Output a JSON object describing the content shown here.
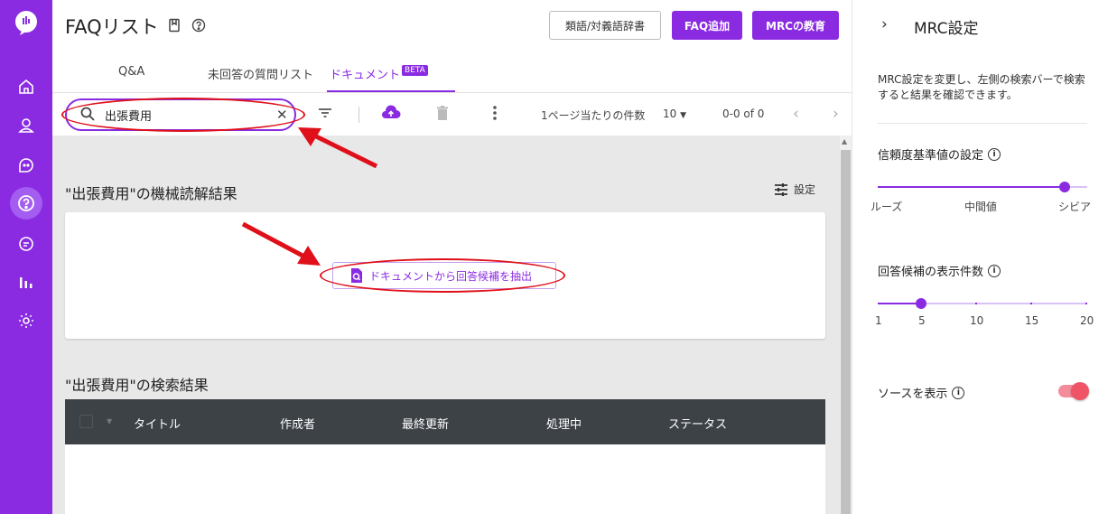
{
  "header": {
    "title": "FAQリスト",
    "synonym_btn": "類語/対義語辞書",
    "faq_add_btn": "FAQ追加",
    "mrc_train_btn": "MRCの教育"
  },
  "tabs": [
    {
      "label": "Q&A"
    },
    {
      "label": "未回答の質問リスト"
    },
    {
      "label": "ドキュメント",
      "badge": "BETA"
    }
  ],
  "toolbar": {
    "search_value": "出張費用",
    "per_page_label": "1ページ当たりの件数",
    "page_size": "10",
    "page_range": "0-0 of 0"
  },
  "mrc_section": {
    "title": "\"出張費用\"の機械読解結果",
    "settings_label": "設定",
    "extract_btn": "ドキュメントから回答候補を抽出"
  },
  "search_section": {
    "title": "\"出張費用\"の検索結果",
    "columns": [
      "タイトル",
      "作成者",
      "最終更新",
      "処理中",
      "ステータス"
    ]
  },
  "right_panel": {
    "title": "MRC設定",
    "description": "MRC設定を変更し、左側の検索バーで検索すると結果を確認できます。",
    "confidence": {
      "label": "信頼度基準値の設定",
      "labels": [
        "ルーズ",
        "中間値",
        "シビア"
      ],
      "value": 0.9
    },
    "candidates": {
      "label": "回答候補の表示件数",
      "ticks": [
        "1",
        "5",
        "10",
        "15",
        "20"
      ],
      "value": 5
    },
    "show_source": {
      "label": "ソースを表示",
      "enabled": true
    }
  },
  "colors": {
    "brand": "#8a2be2",
    "annotation": "#e0101a",
    "toggle": "#ef5467"
  }
}
